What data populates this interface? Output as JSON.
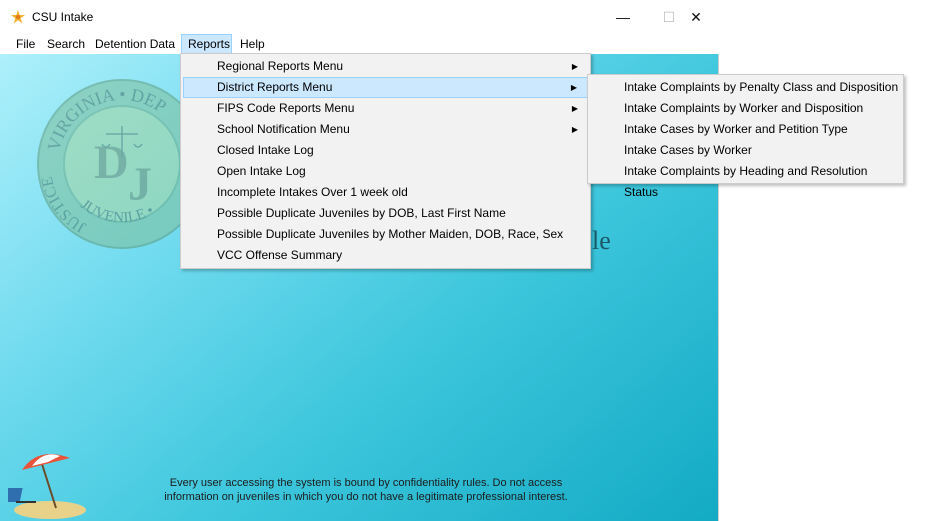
{
  "window": {
    "title": "CSU Intake",
    "controls": {
      "minimize": "—",
      "maximize": "☐",
      "close": "✕"
    }
  },
  "menubar": {
    "items": [
      {
        "label": "File"
      },
      {
        "label": "Search"
      },
      {
        "label": "Detention Data"
      },
      {
        "label": "Reports"
      },
      {
        "label": "Help"
      }
    ]
  },
  "reports_menu": {
    "items": [
      {
        "label": "Regional Reports Menu",
        "arrow": "▶"
      },
      {
        "label": "District Reports Menu",
        "arrow": "▶"
      },
      {
        "label": "FIPS Code Reports Menu",
        "arrow": "▶"
      },
      {
        "label": "School Notification Menu",
        "arrow": "▶"
      },
      {
        "label": "Closed Intake Log"
      },
      {
        "label": "Open Intake Log"
      },
      {
        "label": "Incomplete Intakes Over 1 week old"
      },
      {
        "label": "Possible Duplicate Juveniles by DOB, Last First Name"
      },
      {
        "label": "Possible Duplicate Juveniles by Mother Maiden, DOB, Race, Sex"
      },
      {
        "label": "VCC Offense Summary"
      }
    ]
  },
  "district_submenu": {
    "items": [
      {
        "label": "Intake Complaints by Penalty Class and Disposition"
      },
      {
        "label": "Intake Complaints by Worker and Disposition"
      },
      {
        "label": "Intake Cases by Worker and Petition Type"
      },
      {
        "label": "Intake Cases by Worker"
      },
      {
        "label": "Intake Complaints by Heading and Resolution Status"
      }
    ]
  },
  "background": {
    "seal": {
      "top_text": "VIRGINIA • DEP",
      "left_text": "JUSTICE",
      "bottom_text": "JUVENILE •",
      "monogram_d": "D",
      "monogram_j": "J"
    },
    "partial_title": "le"
  },
  "notice": {
    "line1": "Every user accessing the system is bound by confidentiality rules. Do not access",
    "line2": "information on juveniles in which you do not have a legitimate professional interest."
  }
}
